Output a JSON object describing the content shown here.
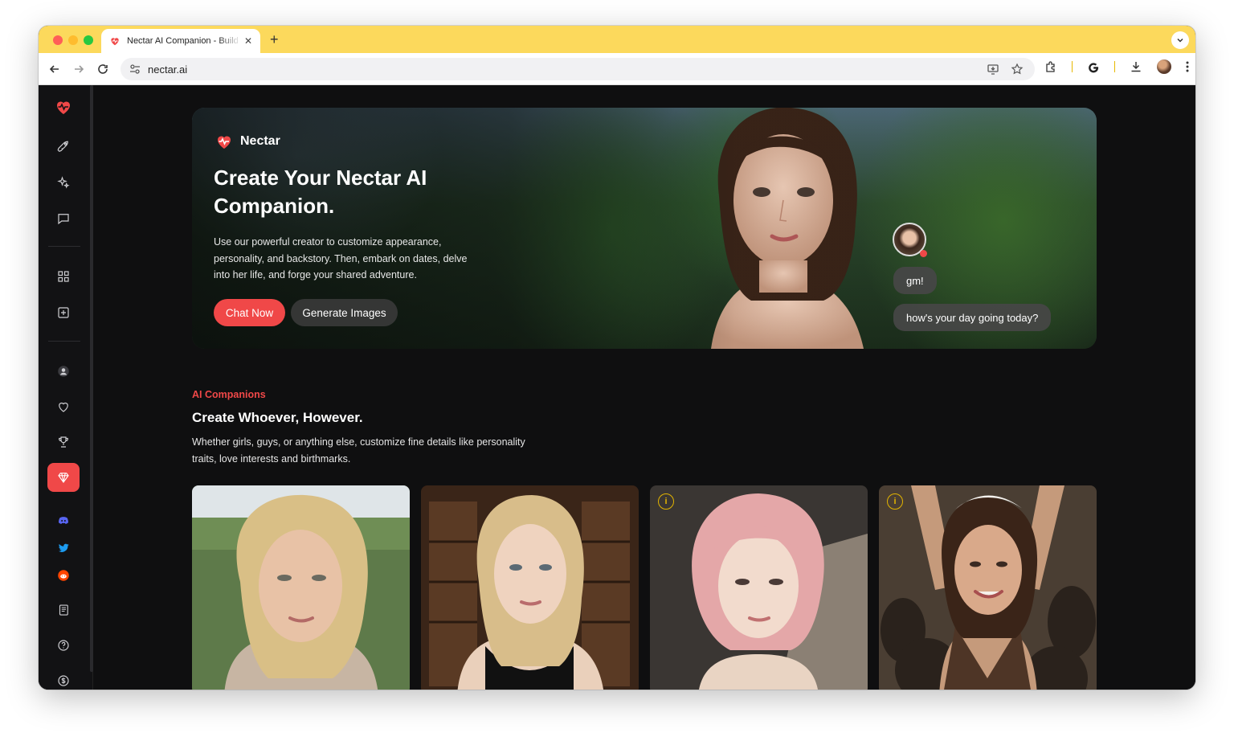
{
  "browser": {
    "tab_title": "Nectar AI Companion - Build",
    "tab_close": "✕",
    "new_tab": "+",
    "url": "nectar.ai",
    "accent": "#fcd95c"
  },
  "sidebar": {
    "items": [
      {
        "icon": "heart-pulse-icon"
      },
      {
        "icon": "rocket-icon"
      },
      {
        "icon": "sparkles-icon"
      },
      {
        "icon": "chat-icon"
      },
      {
        "icon": "grid-icon"
      },
      {
        "icon": "add-square-icon"
      },
      {
        "icon": "user-icon"
      },
      {
        "icon": "heart-icon"
      },
      {
        "icon": "trophy-icon"
      },
      {
        "icon": "gem-icon",
        "active": true
      },
      {
        "icon": "discord-icon"
      },
      {
        "icon": "twitter-icon"
      },
      {
        "icon": "reddit-icon"
      },
      {
        "icon": "blog-icon"
      },
      {
        "icon": "help-icon"
      },
      {
        "icon": "dollar-icon"
      }
    ],
    "active_color": "#f04848"
  },
  "hero": {
    "brand": "Nectar",
    "title": "Create Your Nectar AI Companion.",
    "description": "Use our powerful creator to customize appearance, personality, and backstory. Then, embark on dates, delve into her life, and forge your shared adventure.",
    "chat_button": "Chat Now",
    "generate_button": "Generate Images",
    "bubbles": [
      "gm!",
      "how's your day going today?"
    ]
  },
  "section": {
    "label": "AI Companions",
    "title": "Create Whoever, However.",
    "description": "Whether girls, guys, or anything else, customize fine details like personality traits, love interests and birthmarks."
  },
  "cards": [
    {
      "name": "blonde-woman-outdoors"
    },
    {
      "name": "blonde-woman-library"
    },
    {
      "name": "pink-hair-woman",
      "info": "i"
    },
    {
      "name": "maid-woman",
      "info": "i"
    }
  ]
}
